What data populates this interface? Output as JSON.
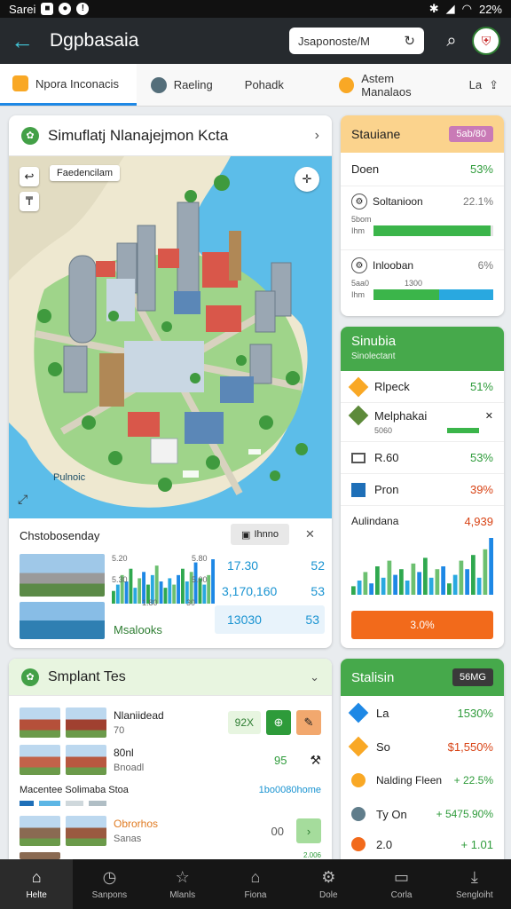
{
  "status": {
    "carrier": "Sarei",
    "battery": "22%"
  },
  "appbar": {
    "title": "Dgpbasaia",
    "search_value": "Jsaponoste/M"
  },
  "tabs": [
    {
      "label": "Npora Inconacis"
    },
    {
      "label": "Raeling"
    },
    {
      "label": "Pohadk"
    },
    {
      "label": "Astem Manalaos"
    },
    {
      "label": "La"
    }
  ],
  "map_card": {
    "title": "Simuflatj Nlanajejmon Kcta",
    "map_label": "Faedencilam",
    "map_corner_text": "Pulnoic",
    "stats_title": "Chstobosenday",
    "stats_chip": "Ihnno",
    "rows": [
      {
        "value": "17.30",
        "secondary": "52"
      },
      {
        "value": "3,170,160",
        "secondary": "53"
      },
      {
        "value": "13030",
        "secondary": "53"
      }
    ],
    "footer_label": "Msalooks",
    "mini_chart_ticks": [
      "5.20",
      "5.80",
      "5.30",
      "5.00",
      "1.80",
      "30"
    ],
    "mini_chart": [
      4,
      6,
      9,
      7,
      11,
      5,
      8,
      10,
      6,
      9,
      12,
      7,
      5,
      8,
      6,
      9,
      11,
      7,
      10,
      13,
      8,
      6,
      9,
      14
    ]
  },
  "stat_card": {
    "title": "Stauiane",
    "badge": "5ab/80",
    "rows": [
      {
        "label": "Doen",
        "value": "53%"
      },
      {
        "label": "Soltanioon",
        "value": "22.1%",
        "sub": "5bom",
        "sub2": "Ihm",
        "progress": 0.98,
        "color": "#3bb54a"
      },
      {
        "label": "Inlooban",
        "value": "6%",
        "sub": "5aa0",
        "sub_right": "1300",
        "sub2": "Ihm",
        "progress": 0.55,
        "color": "#3bb54a",
        "progress2": 0.45,
        "color2": "#29a8e0"
      }
    ]
  },
  "sim_card": {
    "title": "Sinubia",
    "subtitle": "Sinolectant",
    "rows": [
      {
        "label": "Rlpeck",
        "value": "51%"
      },
      {
        "label": "Melphakai",
        "sub": "5060",
        "progress": 0.7
      },
      {
        "label": "R.60",
        "value": "53%"
      },
      {
        "label": "Pron",
        "value": "39%"
      }
    ],
    "chart_title": "Aulindana",
    "chart_value": "4,939",
    "chart_bars": [
      3,
      5,
      8,
      4,
      10,
      6,
      12,
      7,
      9,
      5,
      11,
      8,
      13,
      6,
      9,
      10,
      4,
      7,
      12,
      9,
      14,
      6,
      16,
      20
    ],
    "action": "3.0%"
  },
  "tasks_card": {
    "title": "Smplant Tes",
    "rows": [
      {
        "title": "Nlaniidead",
        "sub": "70",
        "btn": "92X"
      },
      {
        "title": "80nl",
        "sub": "Bnoadl",
        "value": "95"
      }
    ],
    "section_label": "Macentee Solimaba Stoa",
    "section_link": "1bo0080home",
    "last_row": {
      "title": "Obrorhos",
      "sub": "Sanas",
      "value": "00"
    },
    "more_row": {
      "value": "2.006"
    }
  },
  "stats_card": {
    "title": "Stalisin",
    "badge": "56MG",
    "rows": [
      {
        "label": "La",
        "value": "1530%"
      },
      {
        "label": "So",
        "value": "$1,550%"
      },
      {
        "label": "Nalding Fleen",
        "value": "+ 22.5%"
      },
      {
        "label": "Ty On",
        "value": "+ 5475.90%"
      },
      {
        "label": "2.0",
        "value": "+ 1.01"
      }
    ]
  },
  "nav": [
    {
      "label": "Helte",
      "icon": "home-icon"
    },
    {
      "label": "Sanpons",
      "icon": "clock-icon"
    },
    {
      "label": "Mlanls",
      "icon": "star-icon"
    },
    {
      "label": "Fiona",
      "icon": "house-outline-icon"
    },
    {
      "label": "Dole",
      "icon": "gear-icon"
    },
    {
      "label": "Corla",
      "icon": "layout-icon"
    },
    {
      "label": "Sengloiht",
      "icon": "download-icon"
    }
  ]
}
